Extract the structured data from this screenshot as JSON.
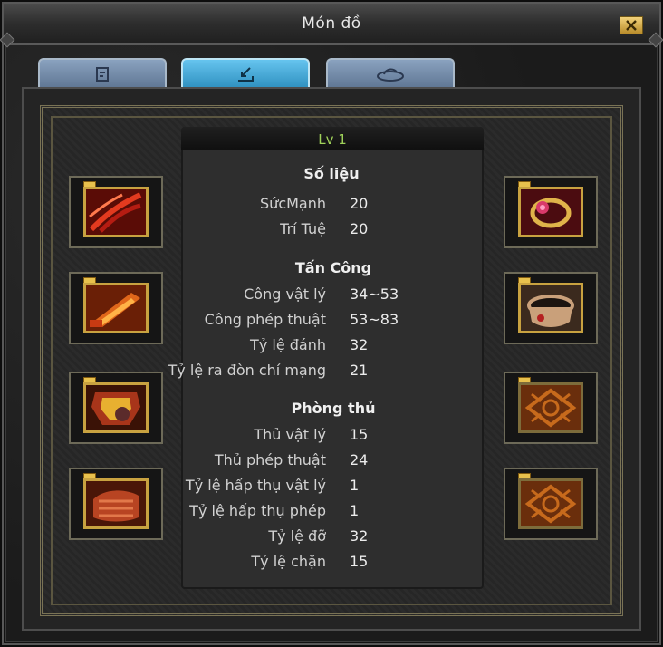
{
  "window": {
    "title": "Món đồ",
    "close_icon": "close-icon"
  },
  "tabs": [
    {
      "icon": "document-icon",
      "active": false
    },
    {
      "icon": "equip-icon",
      "active": true
    },
    {
      "icon": "swirl-icon",
      "active": false
    }
  ],
  "stats": {
    "level": "Lv 1",
    "sections": [
      {
        "title": "Số liệu",
        "rows": [
          {
            "label": "SứcMạnh",
            "value": "20"
          },
          {
            "label": "Trí Tuệ",
            "value": "20"
          }
        ]
      },
      {
        "title": "Tấn Công",
        "rows": [
          {
            "label": "Công vật lý",
            "value": "34~53"
          },
          {
            "label": "Công phép thuật",
            "value": "53~83"
          },
          {
            "label": "Tỷ lệ đánh",
            "value": "32"
          },
          {
            "label": "Tỷ lệ ra đòn chí mạng",
            "value": "21"
          }
        ]
      },
      {
        "title": "Phòng thủ",
        "rows": [
          {
            "label": "Thủ vật lý",
            "value": "15"
          },
          {
            "label": "Thủ phép thuật",
            "value": "24"
          },
          {
            "label": "Tỷ lệ hấp thụ vật lý",
            "value": "1"
          },
          {
            "label": "Tỷ lệ hấp thụ phép",
            "value": "1"
          },
          {
            "label": "Tỷ lệ đỡ",
            "value": "32"
          },
          {
            "label": "Tỷ lệ chặn",
            "value": "15"
          }
        ]
      }
    ]
  },
  "equipment_slots": {
    "left": [
      {
        "item": "sword-slash-icon",
        "color": "#b51c12"
      },
      {
        "item": "blade-icon",
        "color": "#e0661a"
      },
      {
        "item": "armor-icon",
        "color": "#a8351a"
      },
      {
        "item": "boots-icon",
        "color": "#b84422"
      }
    ],
    "right": [
      {
        "item": "ring-icon",
        "color": "#d83a6a"
      },
      {
        "item": "bracelet-icon",
        "color": "#c9a07a"
      },
      {
        "item": "emblem-icon",
        "color": "#c76a1c"
      },
      {
        "item": "emblem-icon",
        "color": "#c76a1c"
      }
    ]
  }
}
